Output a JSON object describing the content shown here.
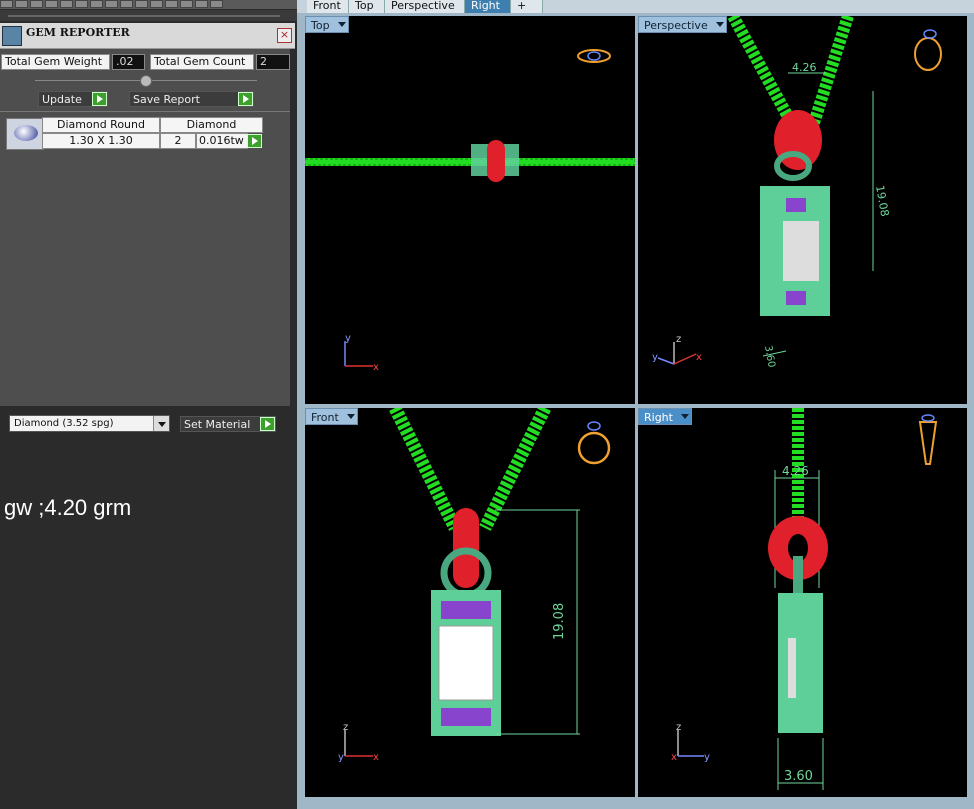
{
  "gem_reporter": {
    "title": "GEM REPORTER",
    "total_weight_label": "Total Gem Weight",
    "total_weight_value": ".02",
    "total_count_label": "Total Gem Count",
    "total_count_value": "2",
    "update_label": "Update",
    "save_report_label": "Save Report",
    "table": {
      "header_shape": "Diamond Round",
      "header_type": "Diamond",
      "size": "1.30 X 1.30",
      "count": "2",
      "weight": "0.016tw"
    }
  },
  "material": {
    "selected": "Diamond    (3.52 spg)",
    "set_label": "Set Material"
  },
  "note": "gw ;4.20 grm",
  "tabs": [
    "Front",
    "Top",
    "Perspective",
    "Right",
    "+"
  ],
  "active_tab": "Right",
  "viewports": {
    "top": {
      "label": "Top"
    },
    "perspective": {
      "label": "Perspective",
      "dim_width": "4.26",
      "dim_height": "19.08",
      "dim_depth": "3.60"
    },
    "front": {
      "label": "Front",
      "dim_height": "19.08"
    },
    "right": {
      "label": "Right",
      "dim_width": "4.26",
      "dim_depth": "3.60"
    }
  },
  "axes": {
    "x": "x",
    "y": "y",
    "z": "z"
  },
  "colors": {
    "chain": "#22dd22",
    "bail": "#e0202a",
    "frame": "#5fcf9a",
    "dim": "#6fd69a"
  }
}
